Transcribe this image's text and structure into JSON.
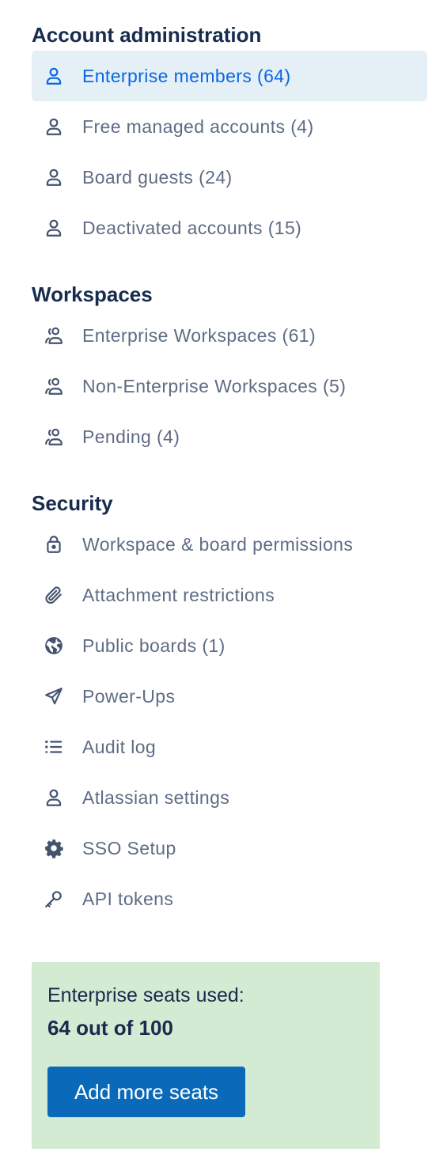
{
  "colors": {
    "heading": "#172b4d",
    "item_text": "#5e6c84",
    "active_text": "#0c66e4",
    "active_bg": "#e4f0f6",
    "seats_bg": "#d3ebd2",
    "button_bg": "#0a6ab9"
  },
  "account_admin": {
    "title": "Account administration",
    "items": [
      {
        "label": "Enterprise members (64)",
        "icon": "person-icon",
        "active": true
      },
      {
        "label": "Free managed accounts (4)",
        "icon": "person-icon"
      },
      {
        "label": "Board guests (24)",
        "icon": "person-icon"
      },
      {
        "label": "Deactivated accounts (15)",
        "icon": "person-icon"
      }
    ]
  },
  "workspaces": {
    "title": "Workspaces",
    "items": [
      {
        "label": "Enterprise Workspaces (61)",
        "icon": "people-icon"
      },
      {
        "label": "Non-Enterprise Workspaces (5)",
        "icon": "people-icon"
      },
      {
        "label": "Pending (4)",
        "icon": "people-icon"
      }
    ]
  },
  "security": {
    "title": "Security",
    "items": [
      {
        "label": "Workspace & board permissions",
        "icon": "lock-icon"
      },
      {
        "label": "Attachment restrictions",
        "icon": "paperclip-icon"
      },
      {
        "label": "Public boards (1)",
        "icon": "globe-icon"
      },
      {
        "label": "Power-Ups",
        "icon": "rocket-icon"
      },
      {
        "label": "Audit log",
        "icon": "list-icon"
      },
      {
        "label": "Atlassian settings",
        "icon": "person-icon"
      },
      {
        "label": "SSO Setup",
        "icon": "gear-icon"
      },
      {
        "label": "API tokens",
        "icon": "key-icon"
      }
    ]
  },
  "seats": {
    "line1": "Enterprise seats used:",
    "line2": "64 out of 100",
    "button_label": "Add more seats",
    "used": 64,
    "total": 100
  }
}
